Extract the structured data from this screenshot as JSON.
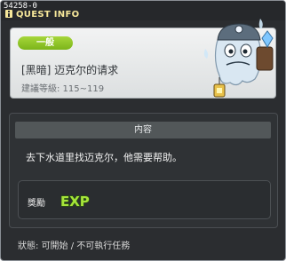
{
  "window": {
    "quest_id": "54258-0",
    "title": "QUEST INFO"
  },
  "header": {
    "category": "一般",
    "quest_name": "[黑暗] 迈克尔的请求",
    "level_requirement": "建議等級: 115~119"
  },
  "content": {
    "section_title": "内容",
    "description": "去下水道里找迈克尔，他需要帮助。"
  },
  "reward": {
    "label": "獎勵",
    "icon": "exp-icon",
    "icon_text": "EXP"
  },
  "status": {
    "text": "狀態: 可開始 / 不可執行任務"
  },
  "colors": {
    "badge": "#8ec42a",
    "title": "#f6e79a",
    "exp": "#a6e43a"
  }
}
